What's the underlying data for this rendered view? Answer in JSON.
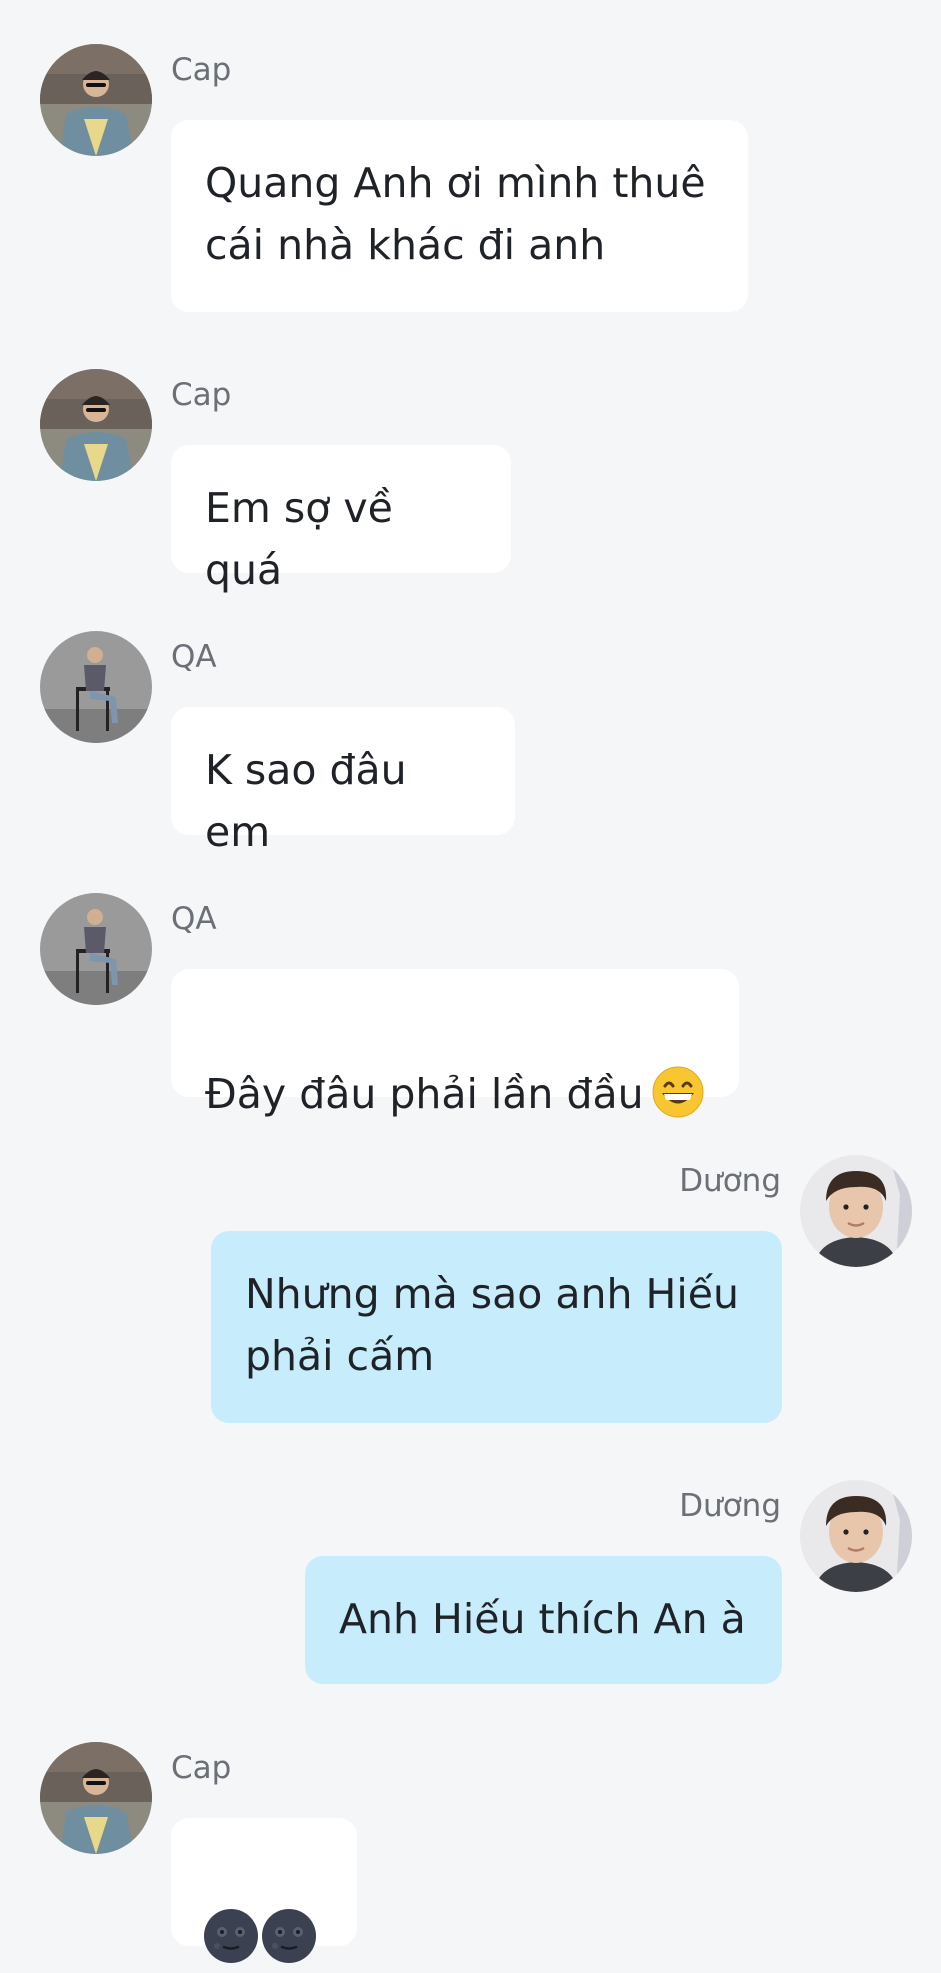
{
  "messages": [
    {
      "sender": "Cap",
      "text": "Quang Anh ơi mình thuê\ncái nhà khác đi anh"
    },
    {
      "sender": "Cap",
      "text": "Em sợ về quá"
    },
    {
      "sender": "QA",
      "text": "K sao đâu em"
    },
    {
      "sender": "QA",
      "text": "Đây đâu phải lần đầu",
      "emoji": "grinning-face-icon"
    },
    {
      "sender": "Dương",
      "text": "Nhưng mà sao anh Hiếu\nphải cấm"
    },
    {
      "sender": "Dương",
      "text": "Anh Hiếu thích An à"
    },
    {
      "sender": "Cap",
      "emoji": "new-moon-face-icon ×2"
    }
  ],
  "colors": {
    "background": "#f5f6f8",
    "incoming_bubble": "#ffffff",
    "outgoing_bubble": "#c7ecfb",
    "sender_name": "#6b6f76",
    "message_text": "#1f2328"
  }
}
